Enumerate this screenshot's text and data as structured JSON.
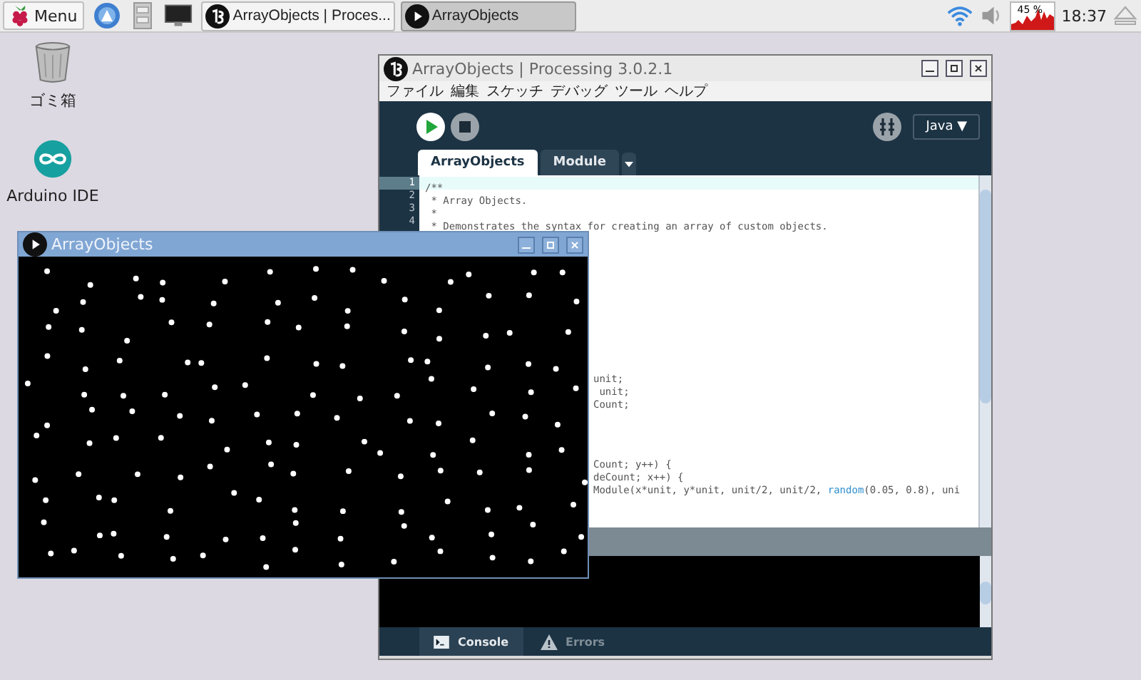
{
  "taskbar": {
    "menu_button": "Menu",
    "tasks": [
      {
        "label": "ArrayObjects | Proces...",
        "kind": "processing",
        "selected": false
      },
      {
        "label": "ArrayObjects",
        "kind": "sketch",
        "selected": true
      }
    ],
    "cpu_reading": "45 %",
    "clock": "18:37"
  },
  "desktop_icons": [
    {
      "label": "ゴミ箱",
      "kind": "trash"
    },
    {
      "label": "Arduino IDE",
      "kind": "arduino"
    }
  ],
  "ide_window": {
    "title": "ArrayObjects | Processing 3.0.2.1",
    "menu": [
      "ファイル",
      "編集",
      "スケッチ",
      "デバッグ",
      "ツール",
      "ヘルプ"
    ],
    "mode": "Java ▼",
    "tabs": [
      {
        "label": "ArrayObjects",
        "selected": true
      },
      {
        "label": "Module",
        "selected": false
      }
    ],
    "code_blocks": [
      {
        "lines": [
          {
            "number": "1",
            "text": "/**",
            "current": true
          },
          {
            "number": "2",
            "text": " * Array Objects.",
            "current": false
          },
          {
            "number": "3",
            "text": " *",
            "current": false
          },
          {
            "number": "4",
            "text": " * Demonstrates the syntax for creating an array of custom objects.",
            "current": false
          }
        ]
      },
      {
        "lines": [
          {
            "text": "unit;"
          },
          {
            "text": " unit;"
          },
          {
            "text": "Count;"
          }
        ]
      },
      {
        "lines": [
          {
            "text": "Count; y++) {"
          },
          {
            "text": "deCount; x++) {"
          },
          {
            "segments": [
              {
                "text": "Module(x*unit, y*unit, unit/2, unit/2, "
              },
              {
                "text": "random",
                "kind": "function"
              },
              {
                "text": "(0.05, 0.8), uni"
              }
            ]
          }
        ]
      }
    ],
    "console_tabs": [
      {
        "label": "Console",
        "kind": "console",
        "selected": true
      },
      {
        "label": "Errors",
        "kind": "errors",
        "selected": false
      }
    ]
  },
  "sketch_window": {
    "title": "ArrayObjects"
  }
}
